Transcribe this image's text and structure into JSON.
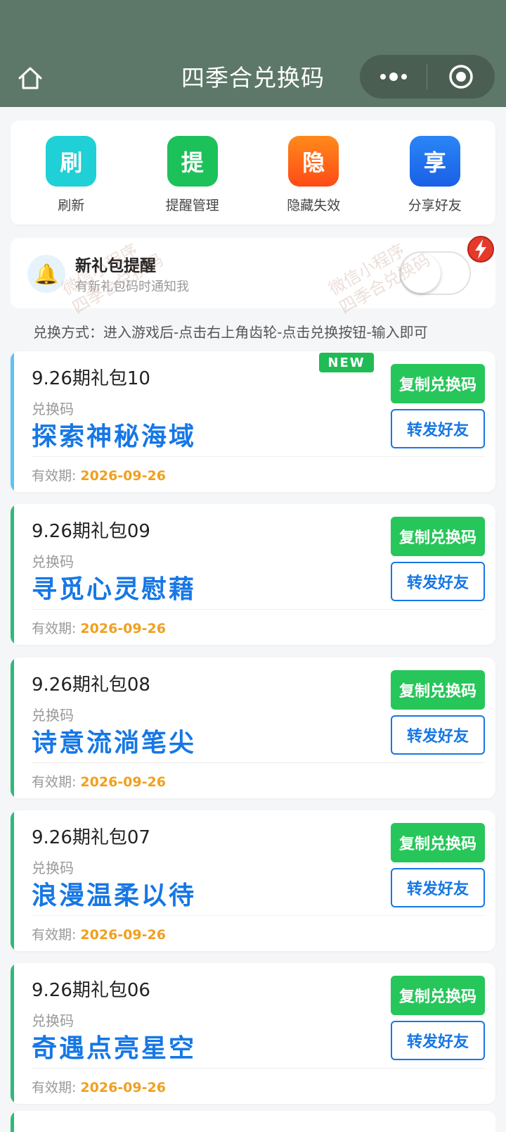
{
  "header": {
    "title": "四季合兑换码"
  },
  "actions": [
    {
      "glyph": "刷",
      "label": "刷新",
      "color": "#1fd0d6"
    },
    {
      "glyph": "提",
      "label": "提醒管理",
      "color": "#1cc15a"
    },
    {
      "glyph": "隐",
      "label": "隐藏失效",
      "color": "#ff6a1a"
    },
    {
      "glyph": "享",
      "label": "分享好友",
      "color": "#1a6ff2"
    }
  ],
  "reminder": {
    "title": "新礼包提醒",
    "subtitle": "有新礼包码时通知我",
    "enabled": false
  },
  "watermark": {
    "line1": "微信小程序",
    "line2": "四季合兑换码"
  },
  "howto": "兑换方式：进入游戏后-点击右上角齿轮-点击兑换按钮-输入即可",
  "new_badge": "NEW",
  "code_label": "兑换码",
  "valid_label": "有效期:",
  "copy_label": "复制兑换码",
  "forward_label": "转发好友",
  "colors": {
    "accent_first": "#5ec3f0",
    "accent": "#2dba7a",
    "code": "#1677e5",
    "date": "#f0a020",
    "copy": "#27c65a"
  },
  "gifts": [
    {
      "name": "9.26期礼包10",
      "code": "探索神秘海域",
      "valid": "2026-09-26"
    },
    {
      "name": "9.26期礼包09",
      "code": "寻觅心灵慰藉",
      "valid": "2026-09-26"
    },
    {
      "name": "9.26期礼包08",
      "code": "诗意流淌笔尖",
      "valid": "2026-09-26"
    },
    {
      "name": "9.26期礼包07",
      "code": "浪漫温柔以待",
      "valid": "2026-09-26"
    },
    {
      "name": "9.26期礼包06",
      "code": "奇遇点亮星空",
      "valid": "2026-09-26"
    }
  ]
}
